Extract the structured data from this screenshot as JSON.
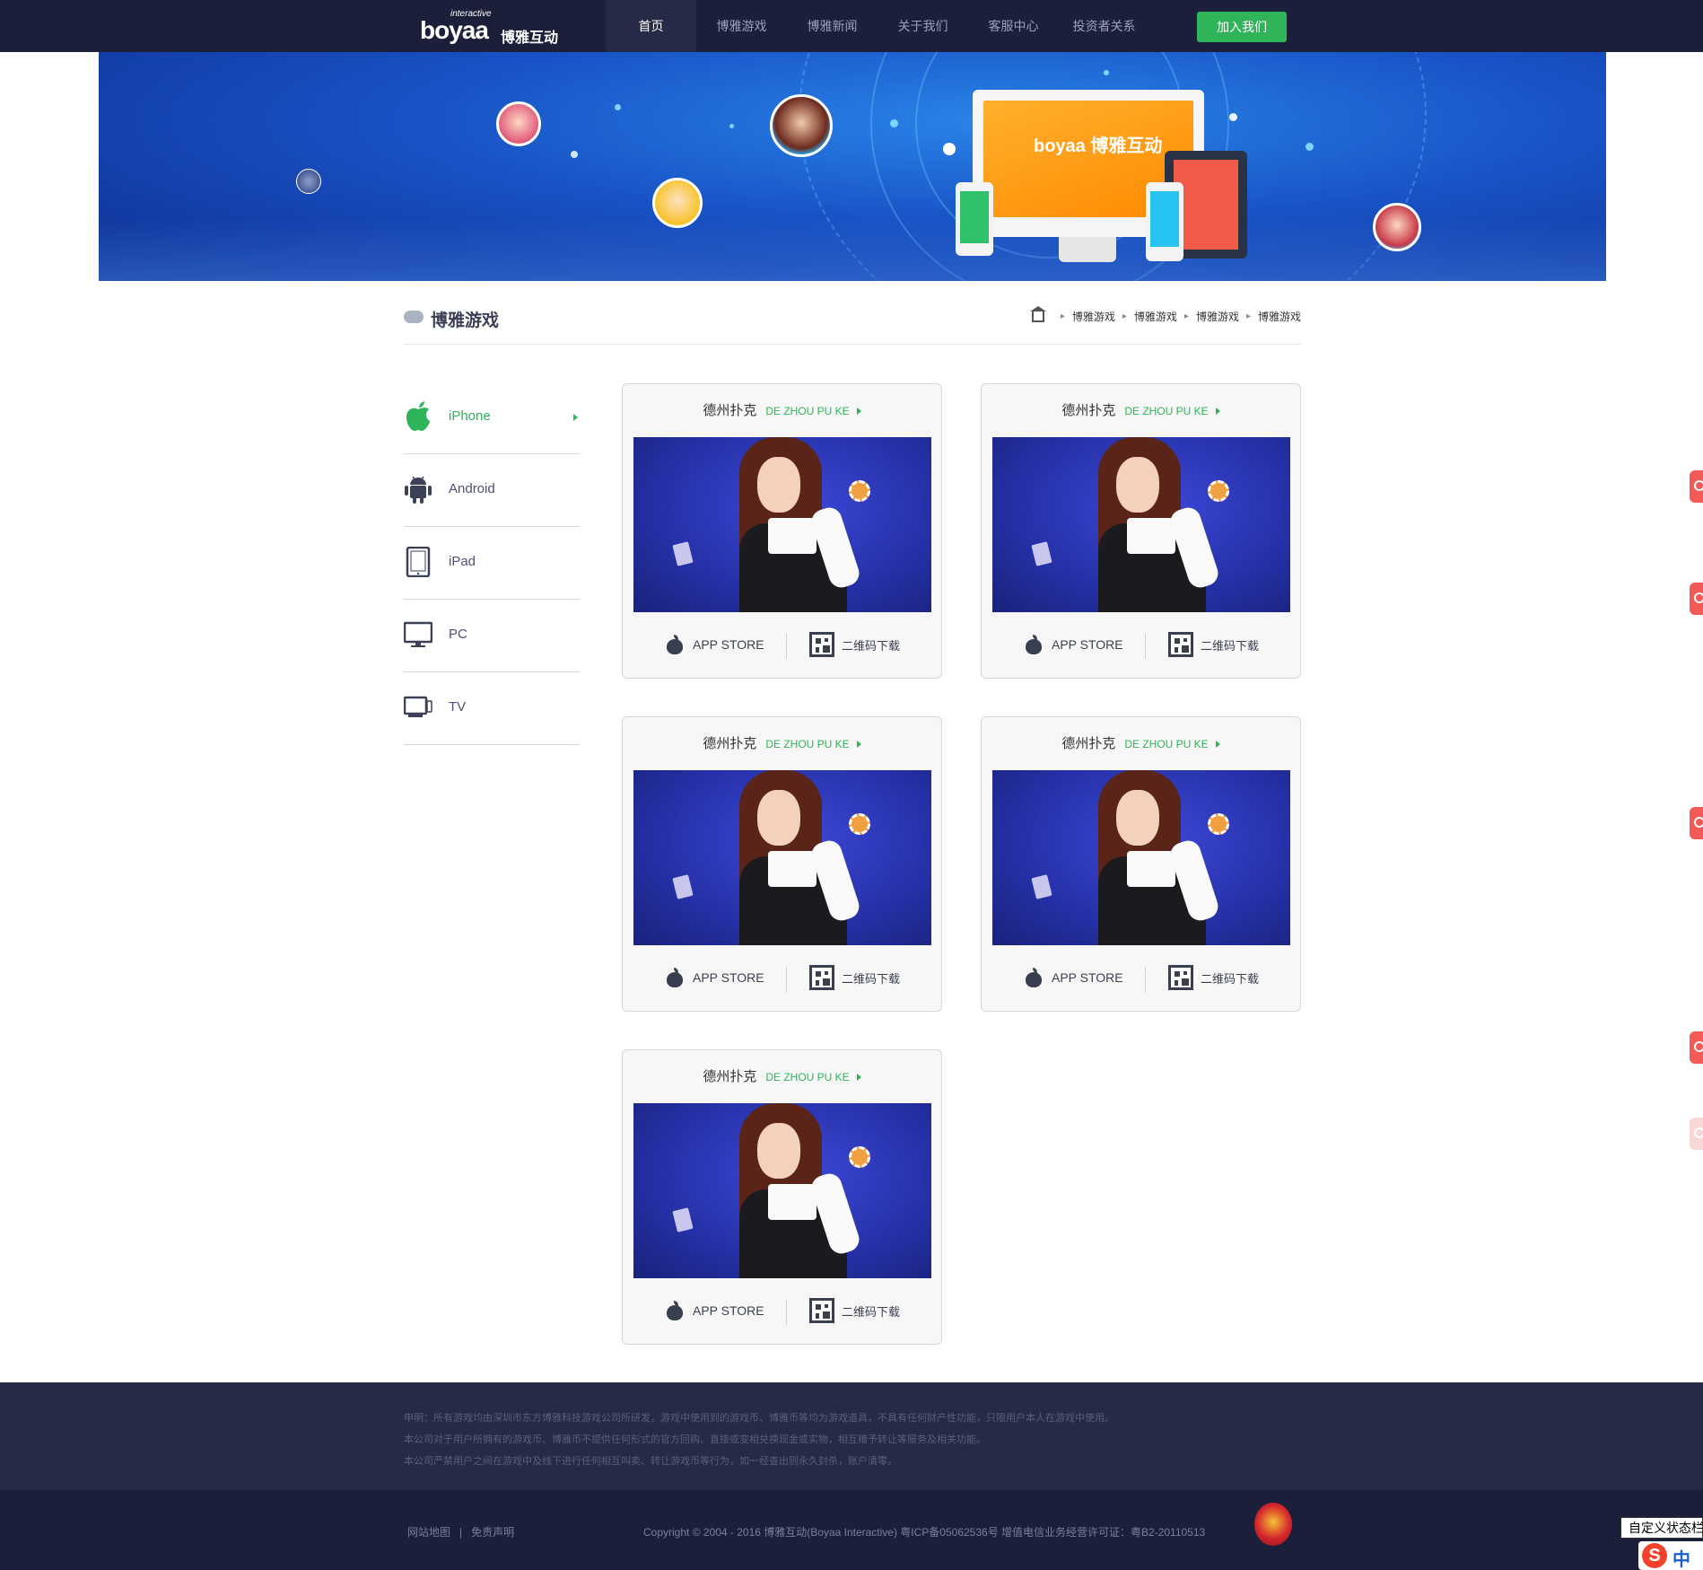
{
  "header": {
    "logo_small": "interactive",
    "logo_big": "boyaa",
    "logo_cn": "博雅互动",
    "nav": [
      "首页",
      "博雅游戏",
      "博雅新闻",
      "关于我们",
      "客服中心",
      "投资者关系"
    ],
    "active_nav": "首页",
    "join_label": "加入我们"
  },
  "banner": {
    "screen_text": "boyaa 博雅互动"
  },
  "section": {
    "title": "博雅游戏",
    "breadcrumb": [
      "博雅游戏",
      "博雅游戏",
      "博雅游戏",
      "博雅游戏"
    ]
  },
  "sidemenu": {
    "items": [
      {
        "label": "iPhone",
        "icon": "apple-icon",
        "active": true
      },
      {
        "label": "Android",
        "icon": "android-icon",
        "active": false
      },
      {
        "label": "iPad",
        "icon": "tablet-icon",
        "active": false
      },
      {
        "label": "PC",
        "icon": "monitor-icon",
        "active": false
      },
      {
        "label": "TV",
        "icon": "tv-icon",
        "active": false
      }
    ]
  },
  "games": [
    {
      "name_cn": "德州扑克",
      "name_en": "DE ZHOU PU KE",
      "store_label": "APP STORE",
      "qr_label": "二维码下载"
    },
    {
      "name_cn": "德州扑克",
      "name_en": "DE ZHOU PU KE",
      "store_label": "APP STORE",
      "qr_label": "二维码下载"
    },
    {
      "name_cn": "德州扑克",
      "name_en": "DE ZHOU PU KE",
      "store_label": "APP STORE",
      "qr_label": "二维码下载"
    },
    {
      "name_cn": "德州扑克",
      "name_en": "DE ZHOU PU KE",
      "store_label": "APP STORE",
      "qr_label": "二维码下载"
    },
    {
      "name_cn": "德州扑克",
      "name_en": "DE ZHOU PU KE",
      "store_label": "APP STORE",
      "qr_label": "二维码下载"
    }
  ],
  "footer": {
    "disclaimer": [
      "申明：所有游戏均由深圳市东方博雅科技游戏公司所研发，游戏中使用到的游戏币、博雅币等均为游戏道具，不具有任何财产性功能，只限用户本人在游戏中使用。",
      "本公司对于用户所拥有的游戏币、博雅币不提供任何形式的官方回购、直接或变相兑换现金或实物，相互赠予转让等服务及相关功能。",
      "本公司严禁用户之间在游戏中及线下进行任何相互叫卖、转让游戏币等行为，如一经查出则永久封杀，账户清零。"
    ],
    "links": [
      "网站地图",
      "免责声明"
    ],
    "copyright": "Copyright © 2004 - 2016 博雅互动(Boyaa Interactive)  粤ICP备05062536号   增值电信业务经营许可证：粤B2-20110513"
  },
  "overlay": {
    "custom_status": "自定义状态栏",
    "ime_logo": "S",
    "ime_lang": "中"
  },
  "colors": {
    "nav_bg": "#1c1f3a",
    "accent_green": "#2fb45a",
    "float_red": "#f25a57"
  }
}
